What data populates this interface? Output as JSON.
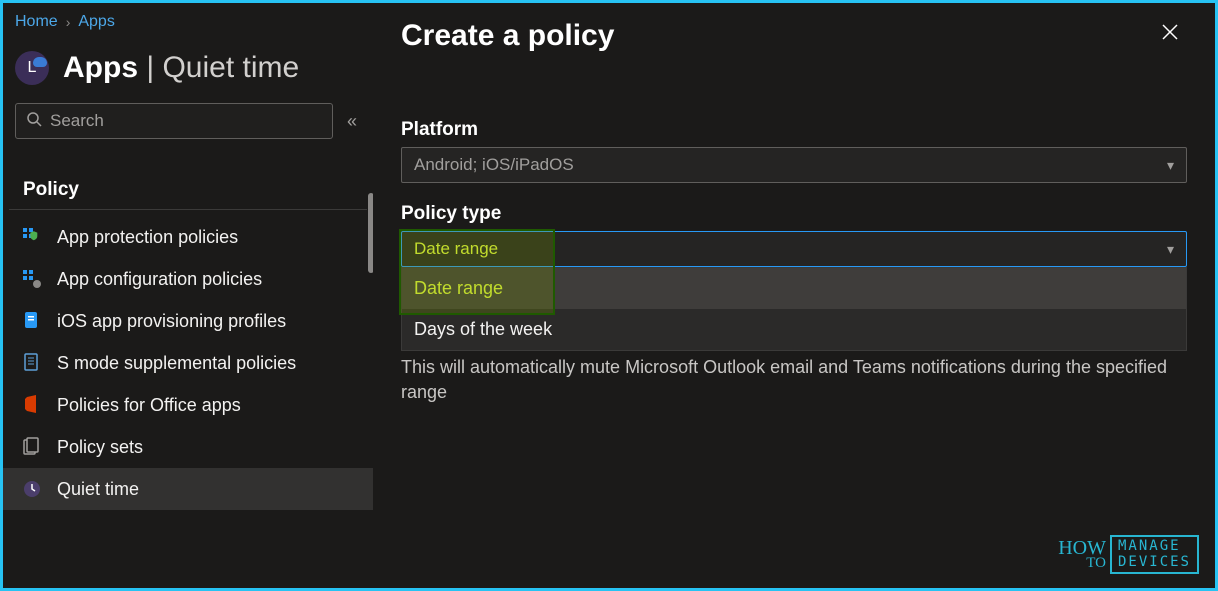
{
  "breadcrumbs": {
    "home": "Home",
    "apps": "Apps"
  },
  "page": {
    "title_main": "Apps",
    "title_sep": " | ",
    "title_sub": "Quiet time",
    "avatar_letter": "L"
  },
  "search": {
    "placeholder": "Search"
  },
  "section": {
    "header": "Policy"
  },
  "nav": {
    "items": [
      {
        "label": "App protection policies"
      },
      {
        "label": "App configuration policies"
      },
      {
        "label": "iOS app provisioning profiles"
      },
      {
        "label": "S mode supplemental policies"
      },
      {
        "label": "Policies for Office apps"
      },
      {
        "label": "Policy sets"
      },
      {
        "label": "Quiet time"
      }
    ]
  },
  "pane": {
    "title": "Create a policy",
    "platform_label": "Platform",
    "platform_value": "Android; iOS/iPadOS",
    "policy_type_label": "Policy type",
    "policy_type_value": "Date range",
    "dropdown": {
      "opt_date_range": "Date range",
      "opt_days": "Days of the week"
    },
    "description": "This will automatically mute Microsoft Outlook email and Teams notifications during the specified range"
  },
  "watermark": {
    "how": "HOW",
    "to": "TO",
    "line1": "MANAGE",
    "line2": "DEVICES"
  }
}
